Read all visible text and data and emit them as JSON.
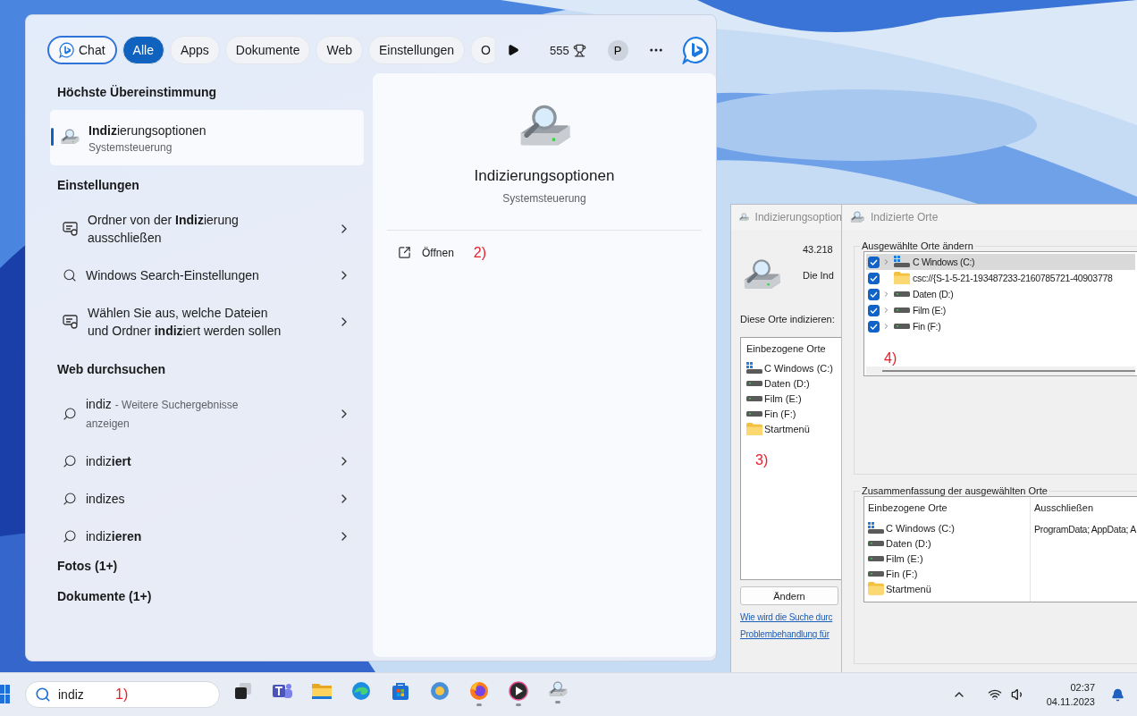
{
  "start_menu": {
    "filters": [
      {
        "label": "Chat",
        "selected": false,
        "kind": "chat"
      },
      {
        "label": "Alle",
        "selected": true,
        "kind": "chip"
      },
      {
        "label": "Apps",
        "selected": false,
        "kind": "chip"
      },
      {
        "label": "Dokumente",
        "selected": false,
        "kind": "chip"
      },
      {
        "label": "Web",
        "selected": false,
        "kind": "chip"
      },
      {
        "label": "Einstellungen",
        "selected": false,
        "kind": "chip"
      },
      {
        "label": "O",
        "selected": false,
        "kind": "chip"
      }
    ],
    "points": "555",
    "avatar": "P",
    "best_match": {
      "heading": "Höchste Übereinstimmung",
      "title": "**Indiz**ierungsoptionen",
      "subtitle": "Systemsteuerung",
      "selected": true
    },
    "sections": [
      {
        "heading": "Einstellungen",
        "items": [
          {
            "kind": "settings",
            "text": "Ordner von der **Indiz**ierung\nausschließen"
          },
          {
            "kind": "search",
            "text": "Windows Search-Einstellungen"
          },
          {
            "kind": "settings",
            "text": "Wählen Sie aus, welche Dateien\nund Ordner **indiz**iert werden sollen"
          }
        ]
      },
      {
        "heading": "Web durchsuchen",
        "items": [
          {
            "kind": "web",
            "text": "indiz",
            "note": "- Weitere Suchergebnisse\nanzeigen"
          },
          {
            "kind": "web",
            "text": "indiz**iert**"
          },
          {
            "kind": "web",
            "text": "indizes"
          },
          {
            "kind": "web",
            "text": "indiz**ieren**"
          }
        ]
      }
    ],
    "categories": [
      "Fotos (1+)",
      "Dokumente (1+)"
    ],
    "detail": {
      "title": "Indizierungsoptionen",
      "subtitle": "Systemsteuerung",
      "action": "Öffnen",
      "annotation": "2)"
    }
  },
  "options_window": {
    "title": "Indizierungsoption",
    "count": "43.218",
    "status": "Die Ind",
    "list_label": "Diese Orte indizieren:",
    "column": "Einbezogene Orte",
    "locations": [
      {
        "kind": "system",
        "name": "C Windows (C:)"
      },
      {
        "kind": "drive",
        "name": "Daten (D:)"
      },
      {
        "kind": "drive",
        "name": "Film (E:)"
      },
      {
        "kind": "drive",
        "name": "Fin (F:)"
      },
      {
        "kind": "folder",
        "name": "Startmenü"
      }
    ],
    "annotation": "3)",
    "button": "Ändern",
    "links": [
      "Wie wird die Suche durc",
      "Problembehandlung für"
    ]
  },
  "locations_window": {
    "title": "Indizierte Orte",
    "tree_label": "Ausgewählte Orte ändern",
    "tree": [
      {
        "kind": "system",
        "name": "C Windows (C:)",
        "checked": true,
        "selected": true,
        "expandable": true
      },
      {
        "kind": "folder",
        "name": "csc://{S-1-5-21-193487233-2160785721-40903778",
        "checked": true,
        "selected": false,
        "expandable": false
      },
      {
        "kind": "drive",
        "name": "Daten (D:)",
        "checked": true,
        "selected": false,
        "expandable": true
      },
      {
        "kind": "drive",
        "name": "Film (E:)",
        "checked": true,
        "selected": false,
        "expandable": true
      },
      {
        "kind": "drive",
        "name": "Fin (F:)",
        "checked": true,
        "selected": false,
        "expandable": true
      }
    ],
    "annotation": "4)",
    "summary_label": "Zusammenfassung der ausgewählten Orte",
    "columns": [
      "Einbezogene Orte",
      "Ausschließen"
    ],
    "included": [
      {
        "kind": "system",
        "name": "C Windows (C:)"
      },
      {
        "kind": "drive",
        "name": "Daten (D:)"
      },
      {
        "kind": "drive",
        "name": "Film (E:)"
      },
      {
        "kind": "drive",
        "name": "Fin (F:)"
      },
      {
        "kind": "folder",
        "name": "Startmenü"
      }
    ],
    "excluded": [
      "ProgramData; AppData; A"
    ]
  },
  "taskbar": {
    "search": {
      "value": "indiz"
    },
    "annotation": "1)",
    "time": "02:37",
    "date": "04.11.2023"
  }
}
